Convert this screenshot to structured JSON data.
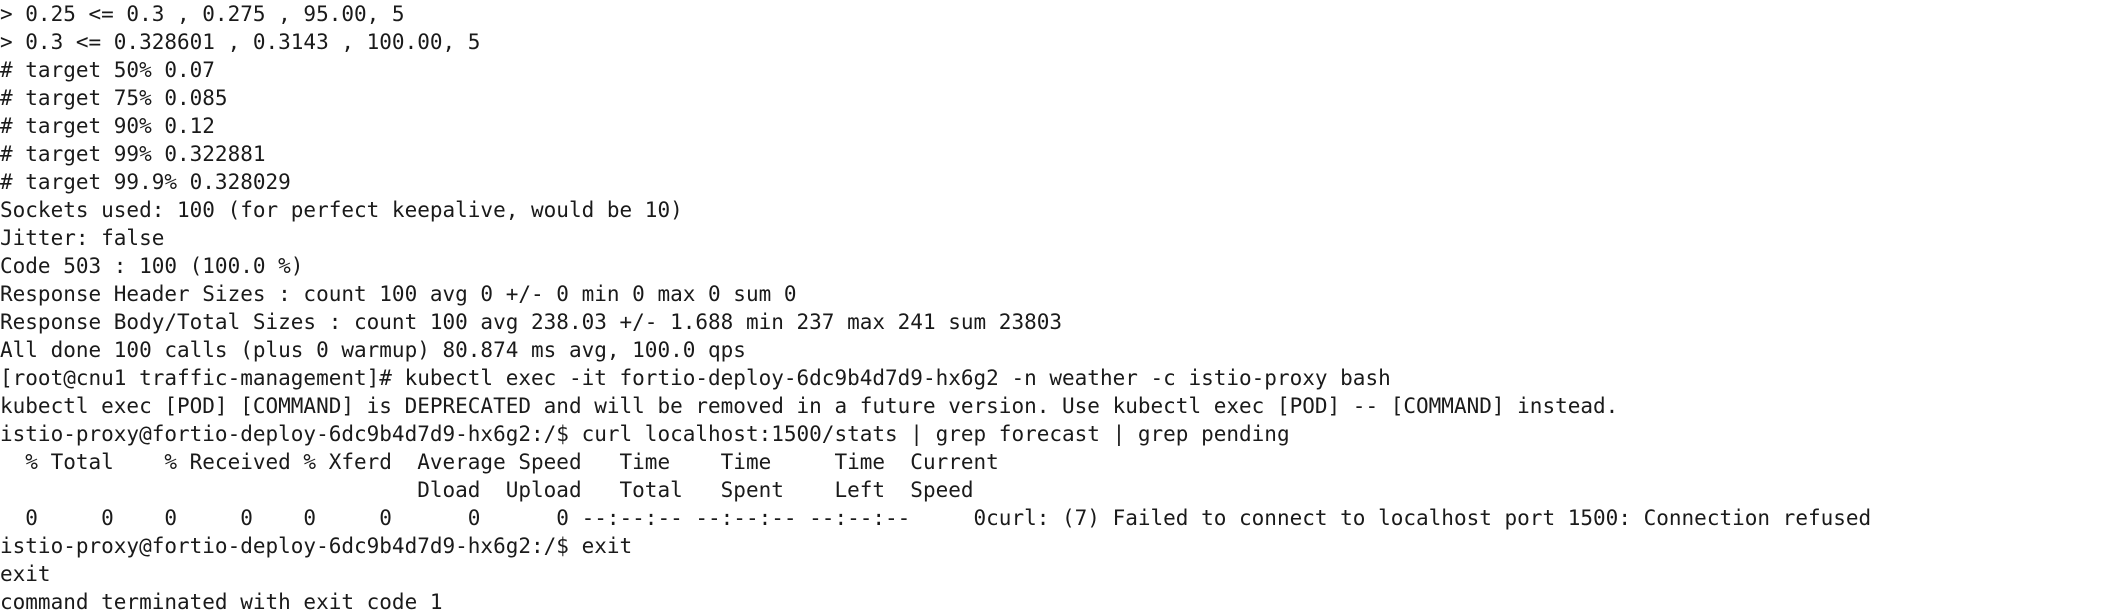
{
  "terminal": {
    "lines": [
      "> 0.25 <= 0.3 , 0.275 , 95.00, 5",
      "> 0.3 <= 0.328601 , 0.3143 , 100.00, 5",
      "# target 50% 0.07",
      "# target 75% 0.085",
      "# target 90% 0.12",
      "# target 99% 0.322881",
      "# target 99.9% 0.328029",
      "Sockets used: 100 (for perfect keepalive, would be 10)",
      "Jitter: false",
      "Code 503 : 100 (100.0 %)",
      "Response Header Sizes : count 100 avg 0 +/- 0 min 0 max 0 sum 0",
      "Response Body/Total Sizes : count 100 avg 238.03 +/- 1.688 min 237 max 241 sum 23803",
      "All done 100 calls (plus 0 warmup) 80.874 ms avg, 100.0 qps",
      "[root@cnu1 traffic-management]# kubectl exec -it fortio-deploy-6dc9b4d7d9-hx6g2 -n weather -c istio-proxy bash",
      "kubectl exec [POD] [COMMAND] is DEPRECATED and will be removed in a future version. Use kubectl exec [POD] -- [COMMAND] instead.",
      "istio-proxy@fortio-deploy-6dc9b4d7d9-hx6g2:/$ curl localhost:1500/stats | grep forecast | grep pending",
      "  % Total    % Received % Xferd  Average Speed   Time    Time     Time  Current",
      "                                 Dload  Upload   Total   Spent    Left  Speed",
      "  0     0    0     0    0     0      0      0 --:--:-- --:--:-- --:--:--     0curl: (7) Failed to connect to localhost port 1500: Connection refused",
      "istio-proxy@fortio-deploy-6dc9b4d7d9-hx6g2:/$ exit",
      "exit",
      "command terminated with exit code 1"
    ]
  }
}
